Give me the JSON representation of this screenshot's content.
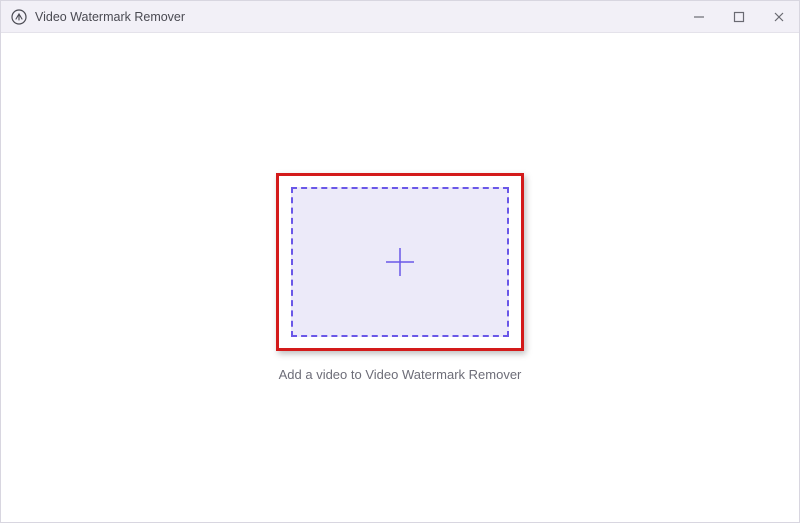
{
  "titlebar": {
    "app_title": "Video Watermark Remover"
  },
  "main": {
    "caption": "Add a video to Video Watermark Remover"
  },
  "colors": {
    "accent": "#6a57e8",
    "highlight": "#d31a1a",
    "dropzone_bg": "#eceaf9",
    "titlebar_bg": "#f2f0f7"
  },
  "icons": {
    "app": "watermark-app-icon",
    "plus": "plus-icon",
    "minimize": "minimize-icon",
    "maximize": "maximize-icon",
    "close": "close-icon"
  }
}
